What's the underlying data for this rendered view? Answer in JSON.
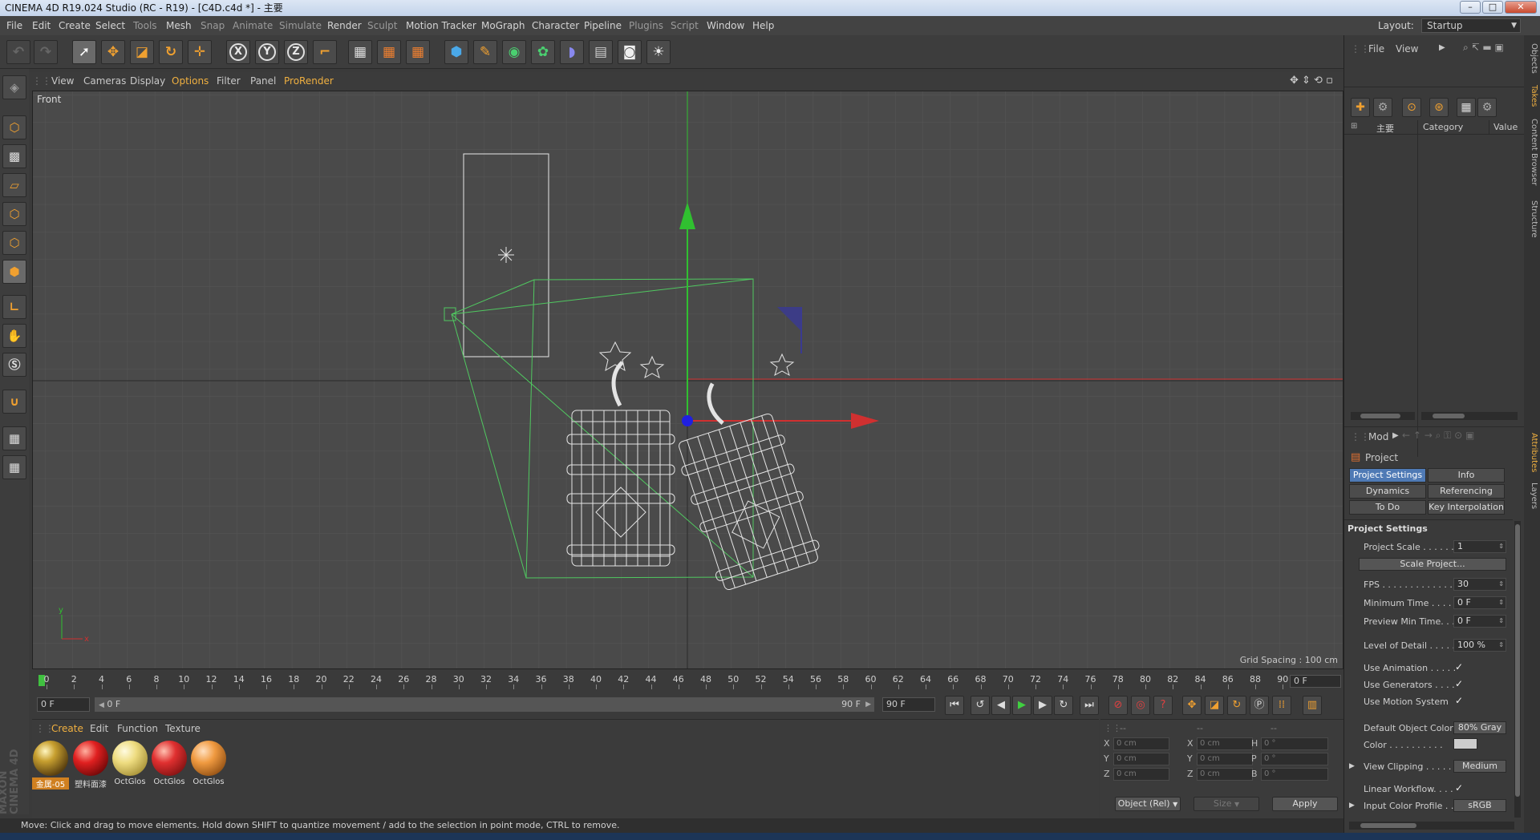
{
  "window": {
    "title": "CINEMA 4D R19.024 Studio (RC - R19) - [C4D.c4d *] - 主要"
  },
  "menu": {
    "items": [
      "File",
      "Edit",
      "Create",
      "Select",
      "Tools",
      "Mesh",
      "Snap",
      "Animate",
      "Simulate",
      "Render",
      "Sculpt",
      "Motion Tracker",
      "MoGraph",
      "Character",
      "Pipeline",
      "Plugins",
      "Script",
      "Window",
      "Help"
    ],
    "layout_label": "Layout:",
    "layout_value": "Startup"
  },
  "toolbar": {
    "axis_x": "X",
    "axis_y": "Y",
    "axis_z": "Z"
  },
  "viewport": {
    "menu": [
      "View",
      "Cameras",
      "Display",
      "Options",
      "Filter",
      "Panel",
      "ProRender"
    ],
    "label": "Front",
    "grid_spacing": "Grid Spacing : 100 cm",
    "axis_y": "y",
    "axis_x": "x"
  },
  "timeline": {
    "ticks": [
      "0",
      "2",
      "4",
      "6",
      "8",
      "10",
      "12",
      "14",
      "16",
      "18",
      "20",
      "22",
      "24",
      "26",
      "28",
      "30",
      "32",
      "34",
      "36",
      "38",
      "40",
      "42",
      "44",
      "46",
      "48",
      "50",
      "52",
      "54",
      "56",
      "58",
      "60",
      "62",
      "64",
      "66",
      "68",
      "70",
      "72",
      "74",
      "76",
      "78",
      "80",
      "82",
      "84",
      "86",
      "88",
      "90"
    ],
    "current_frame": "0 F"
  },
  "transport": {
    "start": "0 F",
    "range_start": "0 F",
    "range_end": "90 F",
    "end": "90 F"
  },
  "materials": {
    "menu": [
      "Create",
      "Edit",
      "Function",
      "Texture"
    ],
    "items": [
      {
        "name": "金属-05",
        "color": "#8a6a20"
      },
      {
        "name": "塑料面漆",
        "color": "#d02020"
      },
      {
        "name": "OctGlos",
        "color": "#e8d070"
      },
      {
        "name": "OctGlos",
        "color": "#d82828"
      },
      {
        "name": "OctGlos",
        "color": "#e89040"
      }
    ],
    "brand": "MAXON CINEMA 4D"
  },
  "coords": {
    "headers": [
      "--",
      "--",
      "--"
    ],
    "rows": [
      {
        "l1": "X",
        "v1": "0 cm",
        "l2": "X",
        "v2": "0 cm",
        "l3": "H",
        "v3": "0 °"
      },
      {
        "l1": "Y",
        "v1": "0 cm",
        "l2": "Y",
        "v2": "0 cm",
        "l3": "P",
        "v3": "0 °"
      },
      {
        "l1": "Z",
        "v1": "0 cm",
        "l2": "Z",
        "v2": "0 cm",
        "l3": "B",
        "v3": "0 °"
      }
    ],
    "mode": "Object (Rel)",
    "size": "Size",
    "apply": "Apply"
  },
  "status": {
    "text": "Move: Click and drag to move elements. Hold down SHIFT to quantize movement / add to the selection in point mode, CTRL to remove."
  },
  "objects_panel": {
    "menu": [
      "File",
      "View"
    ],
    "take_name": "主要",
    "col_category": "Category",
    "col_value": "Value"
  },
  "attributes": {
    "mode": "Mod",
    "object": "Project",
    "tabs": [
      "Project Settings",
      "Info",
      "Dynamics",
      "Referencing",
      "To Do",
      "Key Interpolation"
    ],
    "section": "Project Settings",
    "project_scale_label": "Project Scale . . . . . .",
    "project_scale": "1",
    "scale_button": "Scale Project...",
    "fps_label": "FPS . . . . . . . . . . . . . .",
    "fps": "30",
    "min_time_label": "Minimum Time . . . . .",
    "min_time": "0 F",
    "preview_min_label": "Preview Min Time. . .",
    "preview_min": "0 F",
    "lod_label": "Level of Detail . . . . .",
    "lod": "100 %",
    "use_anim_label": "Use Animation . . . . .",
    "use_gen_label": "Use Generators . . . .",
    "use_motion_label": "Use Motion System",
    "check_mark": "✓",
    "default_color_label": "Default Object Color",
    "default_color": "80% Gray",
    "color_label": "Color . . . . . . . . . .",
    "view_clipping_label": "View Clipping . . . . .",
    "view_clipping": "Medium",
    "linear_wf_label": "Linear Workflow. . . .",
    "input_profile_label": "Input Color Profile . .",
    "input_profile": "sRGB"
  },
  "side_tabs": [
    "Objects",
    "Takes",
    "Content Browser",
    "Structure",
    "Attributes",
    "Layers"
  ]
}
